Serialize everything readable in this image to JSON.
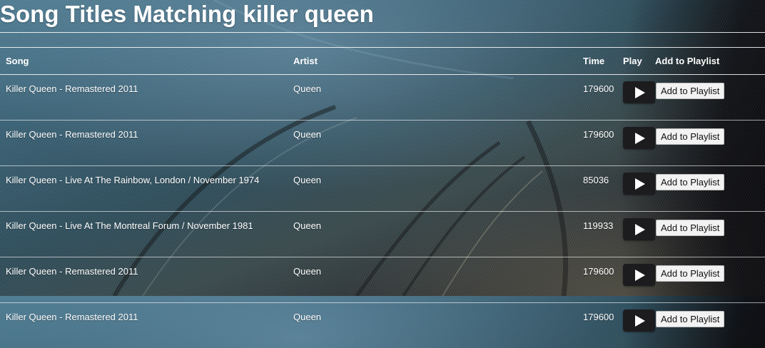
{
  "page": {
    "title": "Song Titles Matching killer queen"
  },
  "table": {
    "headers": {
      "song": "Song",
      "artist": "Artist",
      "time": "Time",
      "play": "Play",
      "add": "Add to Playlist"
    },
    "rows": [
      {
        "song": "Killer Queen - Remastered 2011",
        "artist": "Queen",
        "time": "179600",
        "add_label": "Add to Playlist"
      },
      {
        "song": "Killer Queen - Remastered 2011",
        "artist": "Queen",
        "time": "179600",
        "add_label": "Add to Playlist"
      },
      {
        "song": "Killer Queen - Live At The Rainbow, London / November 1974",
        "artist": "Queen",
        "time": "85036",
        "add_label": "Add to Playlist"
      },
      {
        "song": "Killer Queen - Live At The Montreal Forum / November 1981",
        "artist": "Queen",
        "time": "119933",
        "add_label": "Add to Playlist"
      },
      {
        "song": "Killer Queen - Remastered 2011",
        "artist": "Queen",
        "time": "179600",
        "add_label": "Add to Playlist"
      },
      {
        "song": "Killer Queen - Remastered 2011",
        "artist": "Queen",
        "time": "179600",
        "add_label": "Add to Playlist"
      }
    ]
  },
  "icons": {
    "play": "play-icon",
    "background": "vinyl-record-background"
  },
  "colors": {
    "text": "#ffffff",
    "play_button": "#1c1c1e",
    "add_button": "#f2f2f2"
  }
}
